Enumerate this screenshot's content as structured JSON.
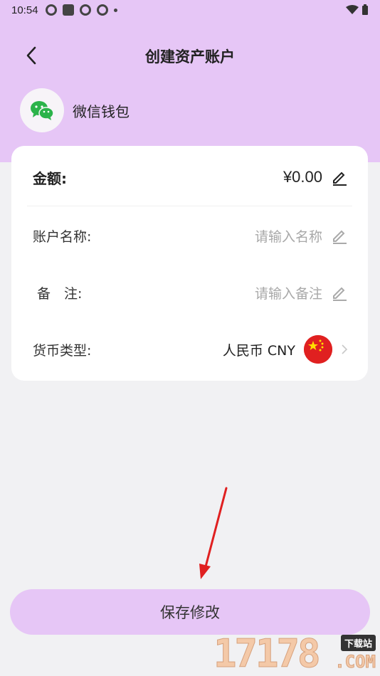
{
  "status_bar": {
    "time": "10:54"
  },
  "header": {
    "title": "创建资产账户"
  },
  "account": {
    "name": "微信钱包",
    "icon": "wechat-icon",
    "icon_color": "#2bb34a"
  },
  "form": {
    "amount": {
      "label": "金额:",
      "value": "¥0.00"
    },
    "account_name": {
      "label": "账户名称:",
      "placeholder": "请输入名称"
    },
    "remark": {
      "label": "备　注:",
      "placeholder": "请输入备注"
    },
    "currency": {
      "label": "货币类型:",
      "value": "人民币 CNY",
      "flag": "china-flag"
    }
  },
  "actions": {
    "save_label": "保存修改"
  },
  "watermark": {
    "number": "17178",
    "tag": "下载站",
    "suffix": ".COM"
  },
  "colors": {
    "header_bg": "#e6c6f6",
    "page_bg": "#f1f1f3",
    "arrow": "#e02020"
  }
}
